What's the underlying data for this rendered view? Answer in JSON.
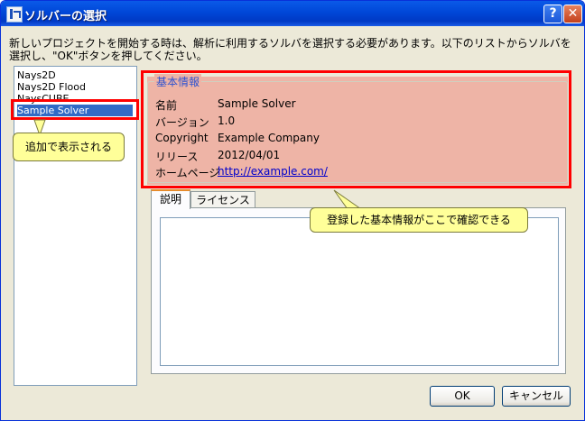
{
  "window": {
    "title": "ソルバーの選択",
    "help_glyph": "?",
    "close_glyph": "✕"
  },
  "instruction": "新しいプロジェクトを開始する時は、解析に利用するソルバを選択する必要があります。以下のリストからソルバを選択し、\"OK\"ボタンを押してください。",
  "solver_list": {
    "items": [
      {
        "label": "Nays2D"
      },
      {
        "label": "Nays2D Flood"
      },
      {
        "label": "NaysCUBE"
      },
      {
        "label": "Sample Solver"
      }
    ],
    "selected_index": 3
  },
  "basic_info": {
    "group_title": "基本情報",
    "rows": [
      {
        "label": "名前",
        "value": "Sample Solver"
      },
      {
        "label": "バージョン",
        "value": "1.0"
      },
      {
        "label": "Copyright",
        "value": "Example Company"
      },
      {
        "label": "リリース",
        "value": "2012/04/01"
      },
      {
        "label": "ホームページ",
        "value": "http://example.com/"
      }
    ],
    "highlight_color": "#eeb4a6"
  },
  "tabs": [
    {
      "label": "説明"
    },
    {
      "label": "ライセンス"
    }
  ],
  "buttons": {
    "ok": "OK",
    "cancel": "キャンセル"
  },
  "callouts": {
    "added": "追加で表示される",
    "info": "登録した基本情報がここで確認できる"
  },
  "colors": {
    "annotation_red": "#ff0000",
    "callout_yellow": "#ffff99",
    "titlebar_blue": "#0047d8"
  }
}
